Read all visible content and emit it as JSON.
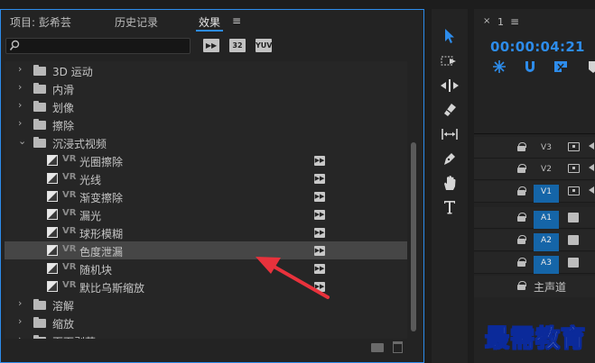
{
  "effects_panel": {
    "tabs": [
      {
        "label": "项目: 彭希芸",
        "active": false
      },
      {
        "label": "历史记录",
        "active": false
      },
      {
        "label": "效果",
        "active": true
      }
    ],
    "menu_glyph": "≡",
    "search": {
      "value": "",
      "placeholder": ""
    },
    "filter_badges": [
      "32",
      "YUV"
    ],
    "tree": [
      {
        "kind": "folder",
        "expanded": false,
        "label": "3D 运动",
        "indent": 0
      },
      {
        "kind": "folder",
        "expanded": false,
        "label": "内滑",
        "indent": 0
      },
      {
        "kind": "folder",
        "expanded": false,
        "label": "划像",
        "indent": 0
      },
      {
        "kind": "folder",
        "expanded": false,
        "label": "擦除",
        "indent": 0
      },
      {
        "kind": "folder",
        "expanded": true,
        "label": "沉浸式视频",
        "indent": 0
      },
      {
        "kind": "effect",
        "vr": "VR",
        "label": "光圈擦除",
        "indent": 1
      },
      {
        "kind": "effect",
        "vr": "VR",
        "label": "光线",
        "indent": 1
      },
      {
        "kind": "effect",
        "vr": "VR",
        "label": "渐变擦除",
        "indent": 1
      },
      {
        "kind": "effect",
        "vr": "VR",
        "label": "漏光",
        "indent": 1
      },
      {
        "kind": "effect",
        "vr": "VR",
        "label": "球形模糊",
        "indent": 1
      },
      {
        "kind": "effect",
        "vr": "VR",
        "label": "色度泄漏",
        "indent": 1,
        "selected": true
      },
      {
        "kind": "effect",
        "vr": "VR",
        "label": "随机块",
        "indent": 1
      },
      {
        "kind": "effect",
        "vr": "VR",
        "label": "默比乌斯缩放",
        "indent": 1
      },
      {
        "kind": "folder",
        "expanded": false,
        "label": "溶解",
        "indent": 0
      },
      {
        "kind": "folder",
        "expanded": false,
        "label": "缩放",
        "indent": 0
      },
      {
        "kind": "folder",
        "expanded": false,
        "label": "页面剥落",
        "indent": 0
      }
    ]
  },
  "tools": [
    "selection-tool",
    "track-select-tool",
    "ripple-edit-tool",
    "razor-tool",
    "slip-tool",
    "pen-tool",
    "hand-tool",
    "type-tool"
  ],
  "timeline": {
    "close_glyph": "×",
    "sequence_label": "1",
    "menu_glyph": "≡",
    "timecode": "00:00:04:21",
    "tracks": [
      {
        "name": "V3",
        "type": "video",
        "on": false
      },
      {
        "name": "V2",
        "type": "video",
        "on": false
      },
      {
        "name": "V1",
        "type": "video",
        "on": true
      },
      {
        "name": "A1",
        "type": "audio",
        "on": true
      },
      {
        "name": "A2",
        "type": "audio",
        "on": true
      },
      {
        "name": "A3",
        "type": "audio",
        "on": true
      }
    ],
    "master_label": "主声道"
  },
  "watermark": "最需教育",
  "colors": {
    "accent": "#2d8ceb",
    "annotation_arrow": "#e8323c",
    "track_on": "#1565a8"
  }
}
